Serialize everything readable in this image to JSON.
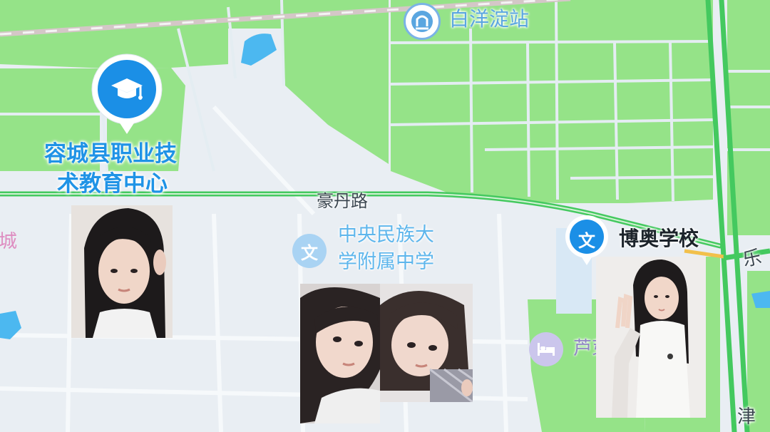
{
  "map": {
    "colors": {
      "land": "#e9eef3",
      "green": "#95e388",
      "road_green": "#44c95f",
      "water": "#4cb8f0",
      "pin_blue": "#1b8fe6",
      "station_ring": "#7ab3e6"
    },
    "pois": [
      {
        "name": "容城县职业技术教育中心",
        "line1": "容城县职业技",
        "line2": "术教育中心",
        "icon": "graduation-cap-icon",
        "type": "school-major"
      },
      {
        "name": "中央民族大学附属中学",
        "line1": "中央民族大",
        "line2": "学附属中学",
        "icon": "wen-school-icon",
        "type": "school-minor"
      },
      {
        "name": "博奥学校",
        "icon": "wen-school-icon",
        "type": "school-pin"
      },
      {
        "name": "白洋淀站",
        "icon": "train-station-icon",
        "type": "station"
      },
      {
        "name": "芦芽",
        "icon": "hotel-bed-icon",
        "type": "hotel"
      }
    ],
    "roads": [
      {
        "name": "豪丹路"
      },
      {
        "name": "乐"
      },
      {
        "name": "津"
      }
    ],
    "edge_labels": [
      {
        "name": "城"
      }
    ],
    "icon_glyphs": {
      "wen": "文"
    },
    "photos": [
      {
        "name": "photo-girl-left",
        "alt": "portrait photo"
      },
      {
        "name": "photo-girl-middle-left",
        "alt": "portrait photo"
      },
      {
        "name": "photo-girl-middle-right",
        "alt": "portrait photo"
      },
      {
        "name": "photo-girl-right",
        "alt": "portrait photo"
      }
    ]
  }
}
